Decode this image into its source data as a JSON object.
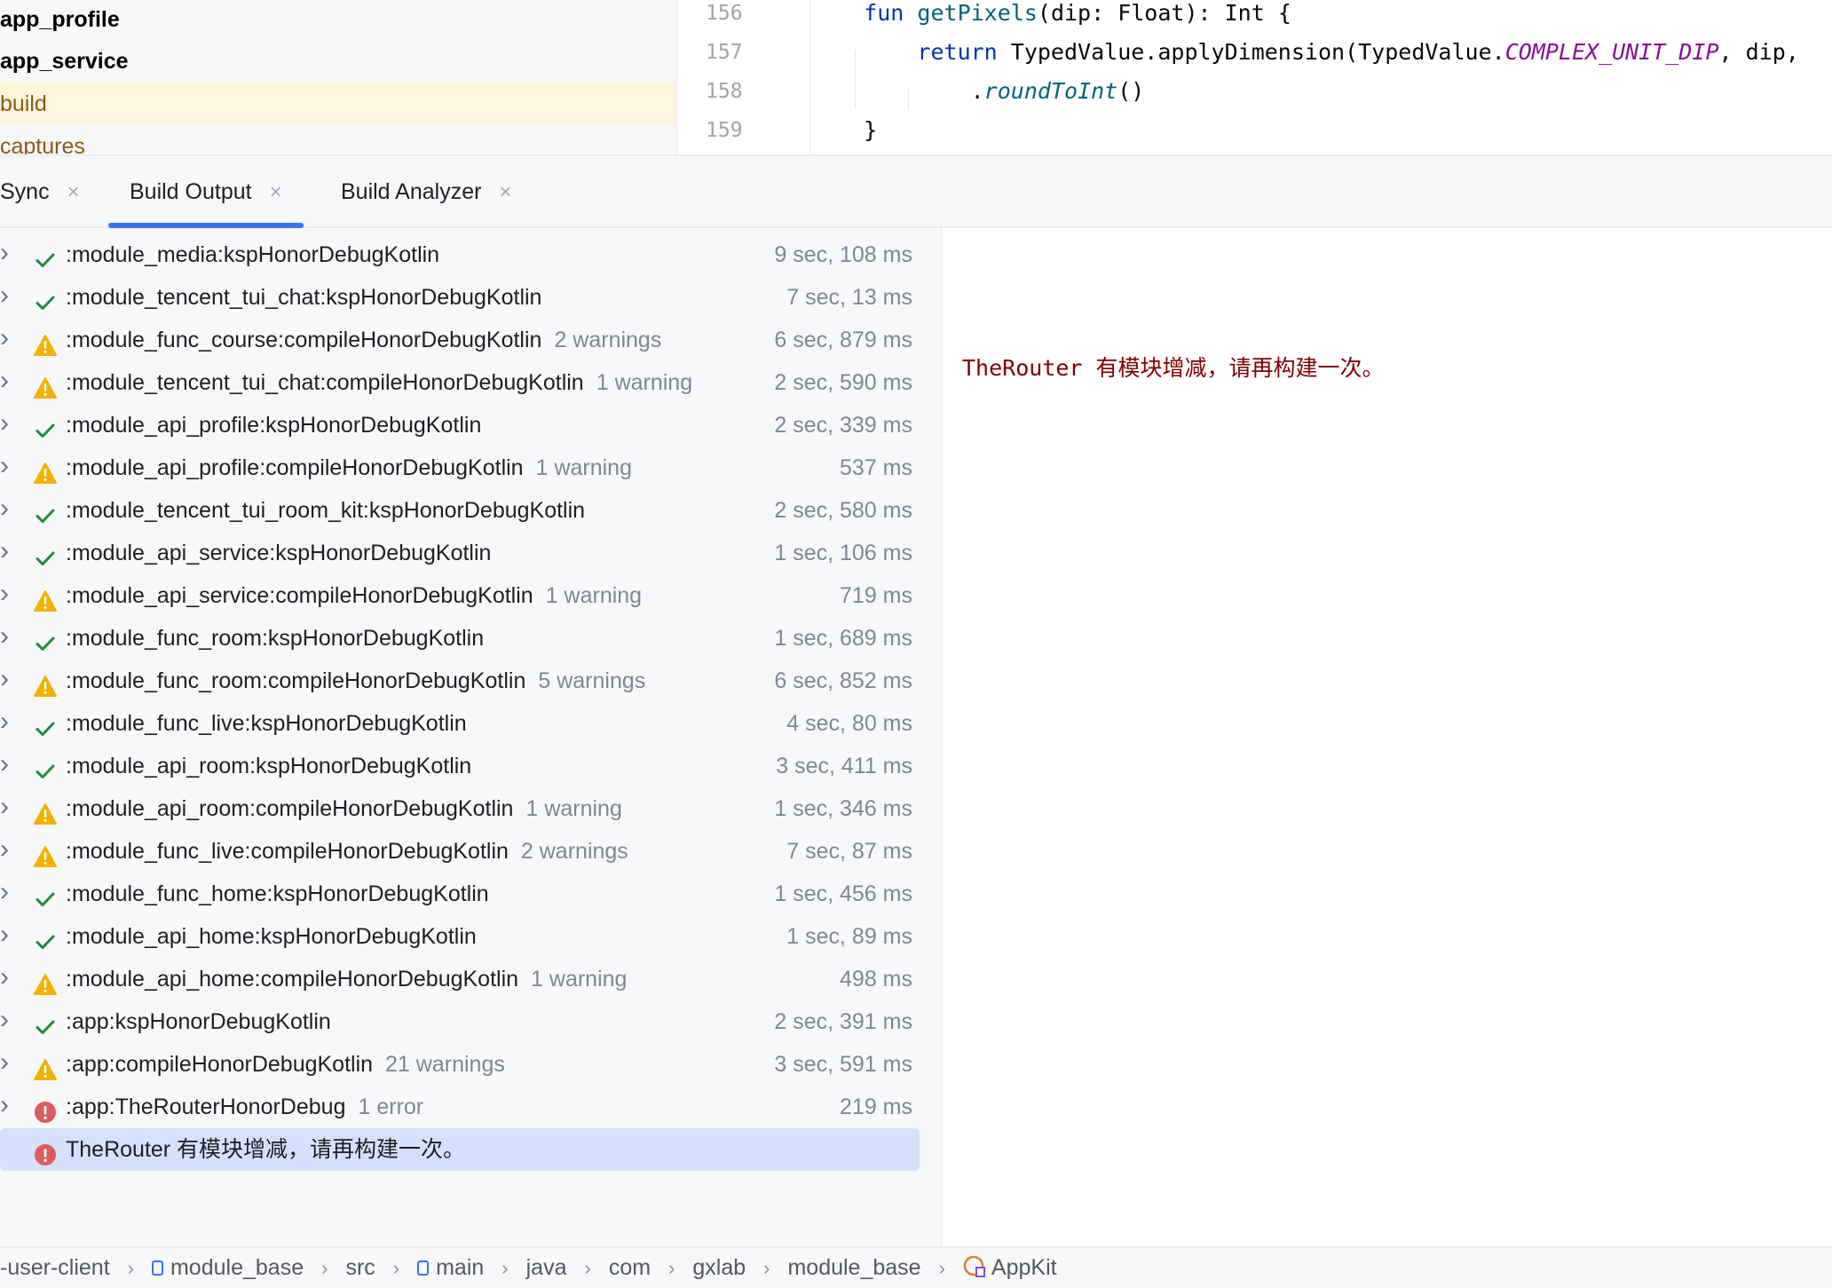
{
  "project_tree": {
    "items": [
      {
        "label": "app_profile",
        "style": "bold"
      },
      {
        "label": "app_service",
        "style": "bold"
      },
      {
        "label": "build",
        "style": "excluded",
        "selected": true
      },
      {
        "label": "captures",
        "style": "excluded"
      }
    ]
  },
  "editor": {
    "line_numbers": [
      "156",
      "157",
      "158",
      "159"
    ],
    "lines": [
      [
        {
          "t": "    fun ",
          "c": "kw"
        },
        {
          "t": "getPixels",
          "c": "fn"
        },
        {
          "t": "(dip: Float): Int {",
          "c": ""
        }
      ],
      [
        {
          "t": "        return ",
          "c": "kw"
        },
        {
          "t": "TypedValue.applyDimension(TypedValue.",
          "c": ""
        },
        {
          "t": "COMPLEX_UNIT_DIP",
          "c": "const"
        },
        {
          "t": ", dip, ",
          "c": ""
        }
      ],
      [
        {
          "t": "            .",
          "c": ""
        },
        {
          "t": "roundToInt",
          "c": "ext"
        },
        {
          "t": "()",
          "c": ""
        }
      ],
      [
        {
          "t": "    }",
          "c": ""
        }
      ]
    ]
  },
  "tabs": [
    {
      "label": "Sync",
      "active": false
    },
    {
      "label": "Build Output",
      "active": true
    },
    {
      "label": "Build Analyzer",
      "active": false
    }
  ],
  "tab_close": "×",
  "build_rows": [
    {
      "status": "success",
      "name": ":module_media:kspHonorDebugKotlin",
      "note": "",
      "time": "9 sec, 108 ms"
    },
    {
      "status": "success",
      "name": ":module_tencent_tui_chat:kspHonorDebugKotlin",
      "note": "",
      "time": "7 sec, 13 ms"
    },
    {
      "status": "warning",
      "name": ":module_func_course:compileHonorDebugKotlin",
      "note": "2 warnings",
      "time": "6 sec, 879 ms"
    },
    {
      "status": "warning",
      "name": ":module_tencent_tui_chat:compileHonorDebugKotlin",
      "note": "1 warning",
      "time": "2 sec, 590 ms"
    },
    {
      "status": "success",
      "name": ":module_api_profile:kspHonorDebugKotlin",
      "note": "",
      "time": "2 sec, 339 ms"
    },
    {
      "status": "warning",
      "name": ":module_api_profile:compileHonorDebugKotlin",
      "note": "1 warning",
      "time": "537 ms"
    },
    {
      "status": "success",
      "name": ":module_tencent_tui_room_kit:kspHonorDebugKotlin",
      "note": "",
      "time": "2 sec, 580 ms"
    },
    {
      "status": "success",
      "name": ":module_api_service:kspHonorDebugKotlin",
      "note": "",
      "time": "1 sec, 106 ms"
    },
    {
      "status": "warning",
      "name": ":module_api_service:compileHonorDebugKotlin",
      "note": "1 warning",
      "time": "719 ms"
    },
    {
      "status": "success",
      "name": ":module_func_room:kspHonorDebugKotlin",
      "note": "",
      "time": "1 sec, 689 ms"
    },
    {
      "status": "warning",
      "name": ":module_func_room:compileHonorDebugKotlin",
      "note": "5 warnings",
      "time": "6 sec, 852 ms"
    },
    {
      "status": "success",
      "name": ":module_func_live:kspHonorDebugKotlin",
      "note": "",
      "time": "4 sec, 80 ms"
    },
    {
      "status": "success",
      "name": ":module_api_room:kspHonorDebugKotlin",
      "note": "",
      "time": "3 sec, 411 ms"
    },
    {
      "status": "warning",
      "name": ":module_api_room:compileHonorDebugKotlin",
      "note": "1 warning",
      "time": "1 sec, 346 ms"
    },
    {
      "status": "warning",
      "name": ":module_func_live:compileHonorDebugKotlin",
      "note": "2 warnings",
      "time": "7 sec, 87 ms"
    },
    {
      "status": "success",
      "name": ":module_func_home:kspHonorDebugKotlin",
      "note": "",
      "time": "1 sec, 456 ms"
    },
    {
      "status": "success",
      "name": ":module_api_home:kspHonorDebugKotlin",
      "note": "",
      "time": "1 sec, 89 ms"
    },
    {
      "status": "warning",
      "name": ":module_api_home:compileHonorDebugKotlin",
      "note": "1 warning",
      "time": "498 ms"
    },
    {
      "status": "success",
      "name": ":app:kspHonorDebugKotlin",
      "note": "",
      "time": "2 sec, 391 ms"
    },
    {
      "status": "warning",
      "name": ":app:compileHonorDebugKotlin",
      "note": "21 warnings",
      "time": "3 sec, 591 ms"
    },
    {
      "status": "error",
      "name": ":app:TheRouterHonorDebug",
      "note": "1 error",
      "time": "219 ms"
    },
    {
      "status": "error",
      "name": "TheRouter 有模块增减，请再构建一次。",
      "note": "",
      "time": "",
      "selected": true,
      "child": true
    }
  ],
  "detail": {
    "message": "TheRouter 有模块增减，请再构建一次。"
  },
  "breadcrumb": [
    {
      "label": "-user-client",
      "icon": ""
    },
    {
      "label": "module_base",
      "icon": "module"
    },
    {
      "label": "src",
      "icon": ""
    },
    {
      "label": "main",
      "icon": "module"
    },
    {
      "label": "java",
      "icon": ""
    },
    {
      "label": "com",
      "icon": ""
    },
    {
      "label": "gxlab",
      "icon": ""
    },
    {
      "label": "module_base",
      "icon": ""
    },
    {
      "label": "AppKit",
      "icon": "kotlin-object"
    }
  ],
  "colors": {
    "success": "#208a3c",
    "warning": "#f2b100",
    "error": "#db5c5c",
    "accent": "#3574f0"
  }
}
